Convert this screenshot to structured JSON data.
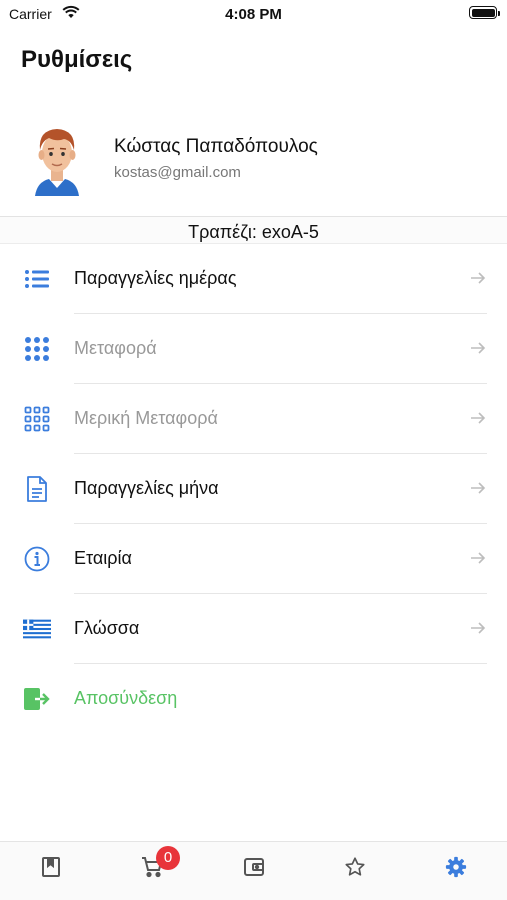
{
  "status_bar": {
    "carrier": "Carrier",
    "time": "4:08 PM"
  },
  "header": {
    "title": "Ρυθμίσεις"
  },
  "profile": {
    "name": "Κώστας Παπαδόπουλος",
    "email": "kostas@gmail.com"
  },
  "table": {
    "label": "Τραπέζι: exoA-5"
  },
  "menu": {
    "items": [
      {
        "label": "Παραγγελίες ημέρας",
        "icon": "list-icon",
        "enabled": true
      },
      {
        "label": "Μεταφορά",
        "icon": "grid-dots-icon",
        "enabled": false
      },
      {
        "label": "Μερική Μεταφορά",
        "icon": "grid-squares-icon",
        "enabled": false
      },
      {
        "label": "Παραγγελίες μήνα",
        "icon": "document-icon",
        "enabled": true
      },
      {
        "label": "Εταιρία",
        "icon": "info-icon",
        "enabled": true
      },
      {
        "label": "Γλώσσα",
        "icon": "greek-flag-icon",
        "enabled": true
      },
      {
        "label": "Αποσύνδεση",
        "icon": "logout-icon",
        "enabled": true
      }
    ]
  },
  "tab_bar": {
    "cart_badge": "0",
    "tabs": [
      "menu-book-icon",
      "cart-icon",
      "wallet-icon",
      "star-icon",
      "settings-gear-icon"
    ],
    "active_tab": "settings-gear-icon"
  },
  "colors": {
    "accent": "#3b7ddd",
    "logout": "#58c364",
    "badge": "#e8343a",
    "disabled_text": "#999999"
  }
}
